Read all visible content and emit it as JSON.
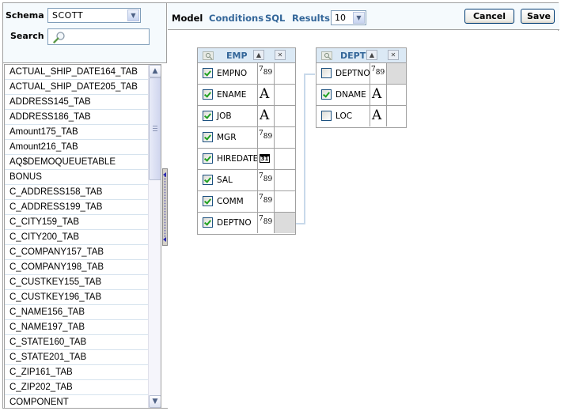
{
  "schema": {
    "label": "Schema",
    "value": "SCOTT"
  },
  "search": {
    "label": "Search",
    "value": "",
    "placeholder": ""
  },
  "object_list": {
    "items": [
      "ACTUAL_SHIP_DATE164_TAB",
      "ACTUAL_SHIP_DATE205_TAB",
      "ADDRESS145_TAB",
      "ADDRESS186_TAB",
      "Amount175_TAB",
      "Amount216_TAB",
      "AQ$DEMOQUEUETABLE",
      "BONUS",
      "C_ADDRESS158_TAB",
      "C_ADDRESS199_TAB",
      "C_CITY159_TAB",
      "C_CITY200_TAB",
      "C_COMPANY157_TAB",
      "C_COMPANY198_TAB",
      "C_CUSTKEY155_TAB",
      "C_CUSTKEY196_TAB",
      "C_NAME156_TAB",
      "C_NAME197_TAB",
      "C_STATE160_TAB",
      "C_STATE201_TAB",
      "C_ZIP161_TAB",
      "C_ZIP202_TAB",
      "COMPONENT"
    ]
  },
  "toolbar": {
    "tabs": [
      {
        "label": "Model",
        "active": true
      },
      {
        "label": "Conditions",
        "active": false
      },
      {
        "label": "SQL",
        "active": false
      },
      {
        "label": "Results",
        "active": false
      }
    ],
    "rows_value": "10",
    "cancel_label": "Cancel",
    "save_label": "Save"
  },
  "tables": [
    {
      "name": "EMP",
      "columns": [
        {
          "name": "EMPNO",
          "checked": true,
          "type": "number",
          "key": ""
        },
        {
          "name": "ENAME",
          "checked": true,
          "type": "text",
          "key": ""
        },
        {
          "name": "JOB",
          "checked": true,
          "type": "text",
          "key": ""
        },
        {
          "name": "MGR",
          "checked": true,
          "type": "number",
          "key": ""
        },
        {
          "name": "HIREDATE",
          "checked": true,
          "type": "date",
          "key": ""
        },
        {
          "name": "SAL",
          "checked": true,
          "type": "number",
          "key": ""
        },
        {
          "name": "COMM",
          "checked": true,
          "type": "number",
          "key": ""
        },
        {
          "name": "DEPTNO",
          "checked": true,
          "type": "number",
          "key": "join"
        }
      ]
    },
    {
      "name": "DEPT",
      "columns": [
        {
          "name": "DEPTNO",
          "checked": false,
          "type": "number",
          "key": "join"
        },
        {
          "name": "DNAME",
          "checked": true,
          "type": "text",
          "key": ""
        },
        {
          "name": "LOC",
          "checked": false,
          "type": "text",
          "key": ""
        }
      ]
    }
  ],
  "type_glyphs": {
    "number": "789",
    "text": "A",
    "date": "31"
  },
  "icons": {
    "table_header": "table-properties-icon",
    "collapse": "▲",
    "close": "✕",
    "dropdown": "▼",
    "scroll_up": "▲",
    "scroll_down": "▼"
  },
  "colors": {
    "tab_link": "#336699",
    "header_bg": "#dbe9f5",
    "join_line": "#c8d9ea",
    "check": "#21a121"
  }
}
